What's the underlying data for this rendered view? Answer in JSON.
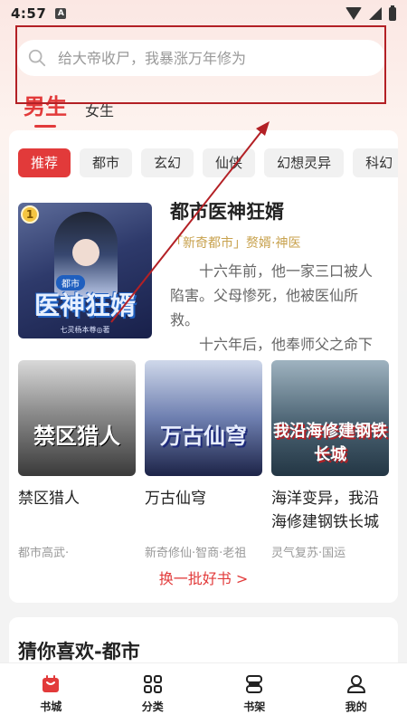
{
  "status_bar": {
    "time": "4:57",
    "badge": "A"
  },
  "search": {
    "placeholder": "给大帝收尸，我暴涨万年修为"
  },
  "gender_tabs": [
    {
      "label": "男生",
      "active": true
    },
    {
      "label": "女生",
      "active": false
    }
  ],
  "categories": [
    "推荐",
    "都市",
    "玄幻",
    "仙侠",
    "幻想灵异",
    "科幻"
  ],
  "featured": {
    "rank": "1",
    "title": "都市医神狂婿",
    "tags": "「新奇都市」赘婿·神医",
    "description": [
      "十六年前，他一家三口被人陷害。父母惨死，他被医仙所救。",
      "十六年后，他奉师父之命下山。入赘宁家，成为豪门赘婿..."
    ],
    "cover_text": {
      "badge": "都市",
      "title": "医神狂婿",
      "author": "七灵杨本尊◎著"
    }
  },
  "books": [
    {
      "title": "禁区猎人",
      "tags": "都市高武·",
      "cover_text": "禁区猎人"
    },
    {
      "title": "万古仙穹",
      "tags": "新奇修仙·智商·老祖",
      "cover_text": "万古仙穹"
    },
    {
      "title": "海洋变异，我沿海修建钢铁长城",
      "tags": "灵气复苏·国运",
      "cover_text": "我沿海修建钢铁长城"
    }
  ],
  "swap_link": "换一批好书 >",
  "section2_title": "猜你喜欢-都市",
  "bottom_nav": [
    {
      "label": "书城",
      "icon": "bookstore-icon",
      "active": true
    },
    {
      "label": "分类",
      "icon": "category-grid-icon",
      "active": false
    },
    {
      "label": "书架",
      "icon": "bookshelf-icon",
      "active": false
    },
    {
      "label": "我的",
      "icon": "profile-icon",
      "active": false
    }
  ],
  "colors": {
    "accent": "#e23a3a",
    "annotation": "#b32025",
    "tag_gold": "#c8a24e"
  }
}
